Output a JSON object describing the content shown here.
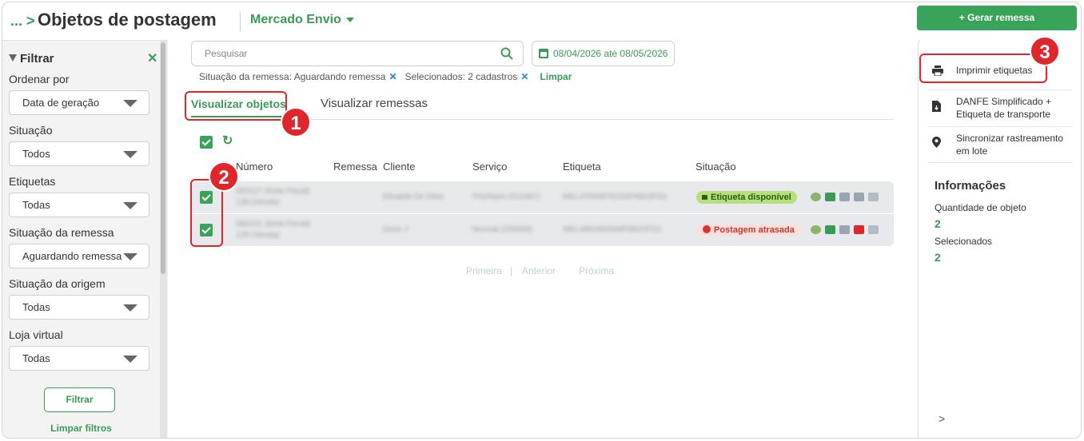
{
  "header": {
    "breadcrumb": "...",
    "title": "Objetos de postagem",
    "integration": "Mercado Envio",
    "gerar_label": "+ Gerar remessa"
  },
  "sidebar": {
    "title": "Filtrar",
    "filters": [
      {
        "label": "Ordenar por",
        "value": "Data de geração"
      },
      {
        "label": "Situação",
        "value": "Todos"
      },
      {
        "label": "Etiquetas",
        "value": "Todas"
      },
      {
        "label": "Situação da remessa",
        "value": "Aguardando remessa"
      },
      {
        "label": "Situação da origem",
        "value": "Todas"
      },
      {
        "label": "Loja virtual",
        "value": "Todas"
      }
    ],
    "filter_button": "Filtrar",
    "clear_label": "Limpar filtros"
  },
  "search": {
    "placeholder": "Pesquisar"
  },
  "date_range": "08/04/2026 até 08/05/2026",
  "active_filters": {
    "chip1": "Situação da remessa: Aguardando remessa",
    "chip2": "Selecionados: 2 cadastros",
    "clear": "Limpar"
  },
  "tabs": [
    {
      "label": "Visualizar objetos",
      "active": true
    },
    {
      "label": "Visualizar remessas",
      "active": false
    }
  ],
  "table": {
    "columns": [
      "Número",
      "Remessa",
      "Cliente",
      "Serviço",
      "Etiqueta",
      "Situação"
    ],
    "rows": [
      {
        "numero_l1": "000117 (Nota Fiscal)",
        "numero_l2": "139 (Venda)",
        "cliente": "Elinalda Da Silva",
        "servico": "Prioritario (011947)",
        "etiqueta": "MEL4700087611DFMDOFD1",
        "situacao": "Etiqueta disponível",
        "checked": true
      },
      {
        "numero_l1": "000101 (Nota Fiscal)",
        "numero_l2": "129 (Venda)",
        "cliente": "Doris J",
        "servico": "Normal (100009)",
        "etiqueta": "MEL4891960DMFMDOFD1",
        "situacao": "Postagem atrasada",
        "checked": true
      }
    ]
  },
  "pagination": {
    "first": "Primeira",
    "sep": "|",
    "prev": "Anterior",
    "next": "Próxima"
  },
  "right_panel": {
    "actions": [
      {
        "label": "Imprimir etiquetas",
        "icon": "printer-icon"
      },
      {
        "label_l1": "DANFE Simplificado +",
        "label_l2": "Etiqueta de transporte",
        "icon": "file-download-icon"
      },
      {
        "label_l1": "Sincronizar rastreamento",
        "label_l2": "em lote",
        "icon": "location-pin-icon"
      }
    ],
    "info_title": "Informações",
    "qty_label": "Quantidade de objeto",
    "qty_value": "2",
    "selected_label": "Selecionados",
    "selected_value": "2"
  },
  "callouts": [
    "1",
    "2",
    "3"
  ],
  "colors": {
    "accent": "#3a9b57",
    "callout": "#e0262a",
    "badge_ok": "#b6e07c",
    "badge_late": "#fde0dd"
  }
}
